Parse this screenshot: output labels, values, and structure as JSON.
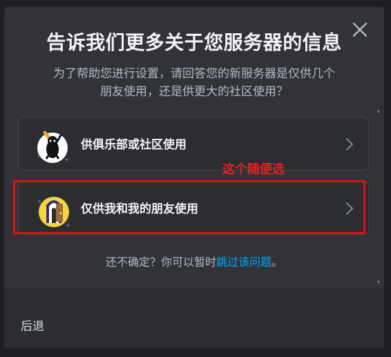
{
  "modal": {
    "title": "告诉我们更多关于您服务器的信息",
    "subtitle": "为了帮助您进行设置，请回答您的新服务器是仅供几个朋友使用，还是供更大的社区使用？"
  },
  "options": [
    {
      "label": "供俱乐部或社区使用",
      "icon": "club-community-icon"
    },
    {
      "label": "仅供我和我的朋友使用",
      "icon": "friends-door-icon"
    }
  ],
  "annotation": {
    "text": "这个随便选",
    "color": "#e01010"
  },
  "skip": {
    "prefix": "还不确定？你可以暂时",
    "link": "跳过该问题",
    "suffix": "。"
  },
  "footer": {
    "back_label": "后退"
  },
  "colors": {
    "background": "#313338",
    "option_bg": "#2b2d31",
    "link": "#00a8fc",
    "annotation": "#e01010"
  }
}
